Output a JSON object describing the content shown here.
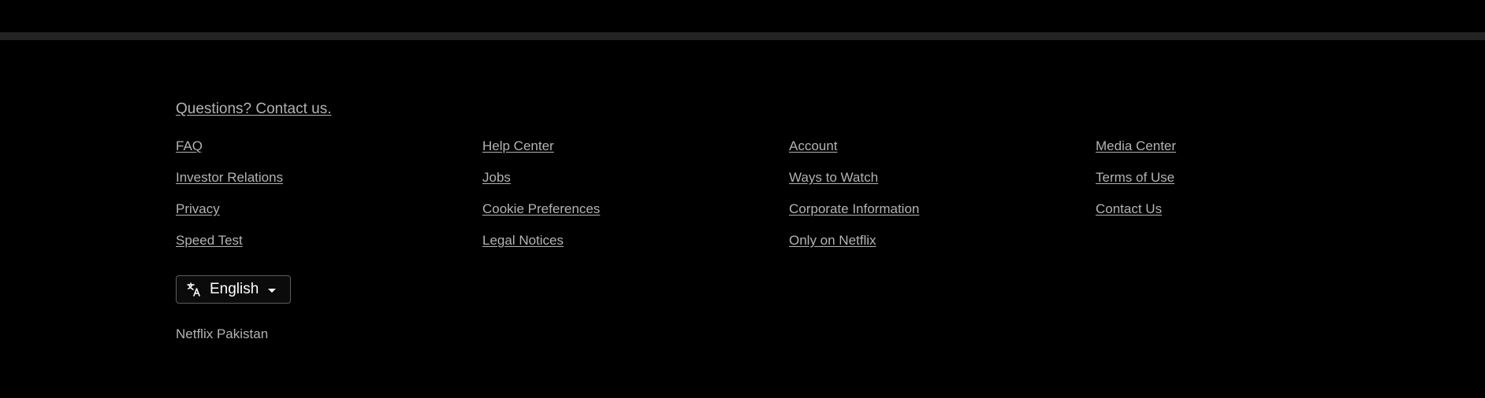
{
  "footer": {
    "contact_label": "Questions? Contact us.",
    "columns": [
      [
        "FAQ",
        "Investor Relations",
        "Privacy",
        "Speed Test"
      ],
      [
        "Help Center",
        "Jobs",
        "Cookie Preferences",
        "Legal Notices"
      ],
      [
        "Account",
        "Ways to Watch",
        "Corporate Information",
        "Only on Netflix"
      ],
      [
        "Media Center",
        "Terms of Use",
        "Contact Us"
      ]
    ],
    "language": {
      "icon": "translate-icon",
      "selected": "English"
    },
    "country_label": "Netflix Pakistan"
  },
  "colors": {
    "background": "#000000",
    "divider": "#232323",
    "link": "#b3b3b3",
    "select_border": "#5c5c5c"
  }
}
